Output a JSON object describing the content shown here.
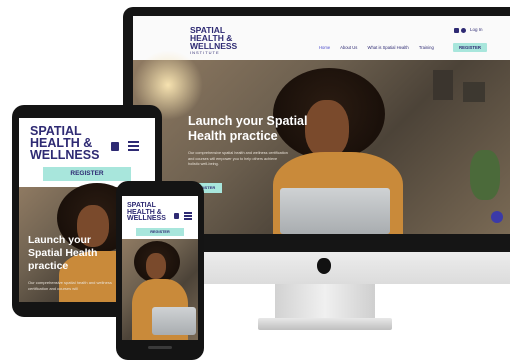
{
  "brand": {
    "line1": "SPATIAL",
    "line2": "HEALTH &",
    "line3": "WELLNESS",
    "sub": "INSTITUTE"
  },
  "desktop": {
    "login": "Log In",
    "nav": [
      "Home",
      "About Us",
      "What is Spatial Health",
      "Training"
    ],
    "register": "REGISTER",
    "hero_title_1": "Launch your Spatial",
    "hero_title_2": "Health practice",
    "hero_body": "Our comprehensive spatial health and wellness certification and courses will empower you to help others achieve holistic well-being."
  },
  "tablet": {
    "register": "REGISTER",
    "hero_title_1": "Launch your",
    "hero_title_2": "Spatial Health",
    "hero_title_3": "practice",
    "hero_body": "Our comprehensive spatial health and wellness certification and courses will"
  },
  "phone": {
    "register": "REGISTER"
  },
  "colors": {
    "brand": "#2e2a73",
    "accent": "#a8e6dc"
  }
}
